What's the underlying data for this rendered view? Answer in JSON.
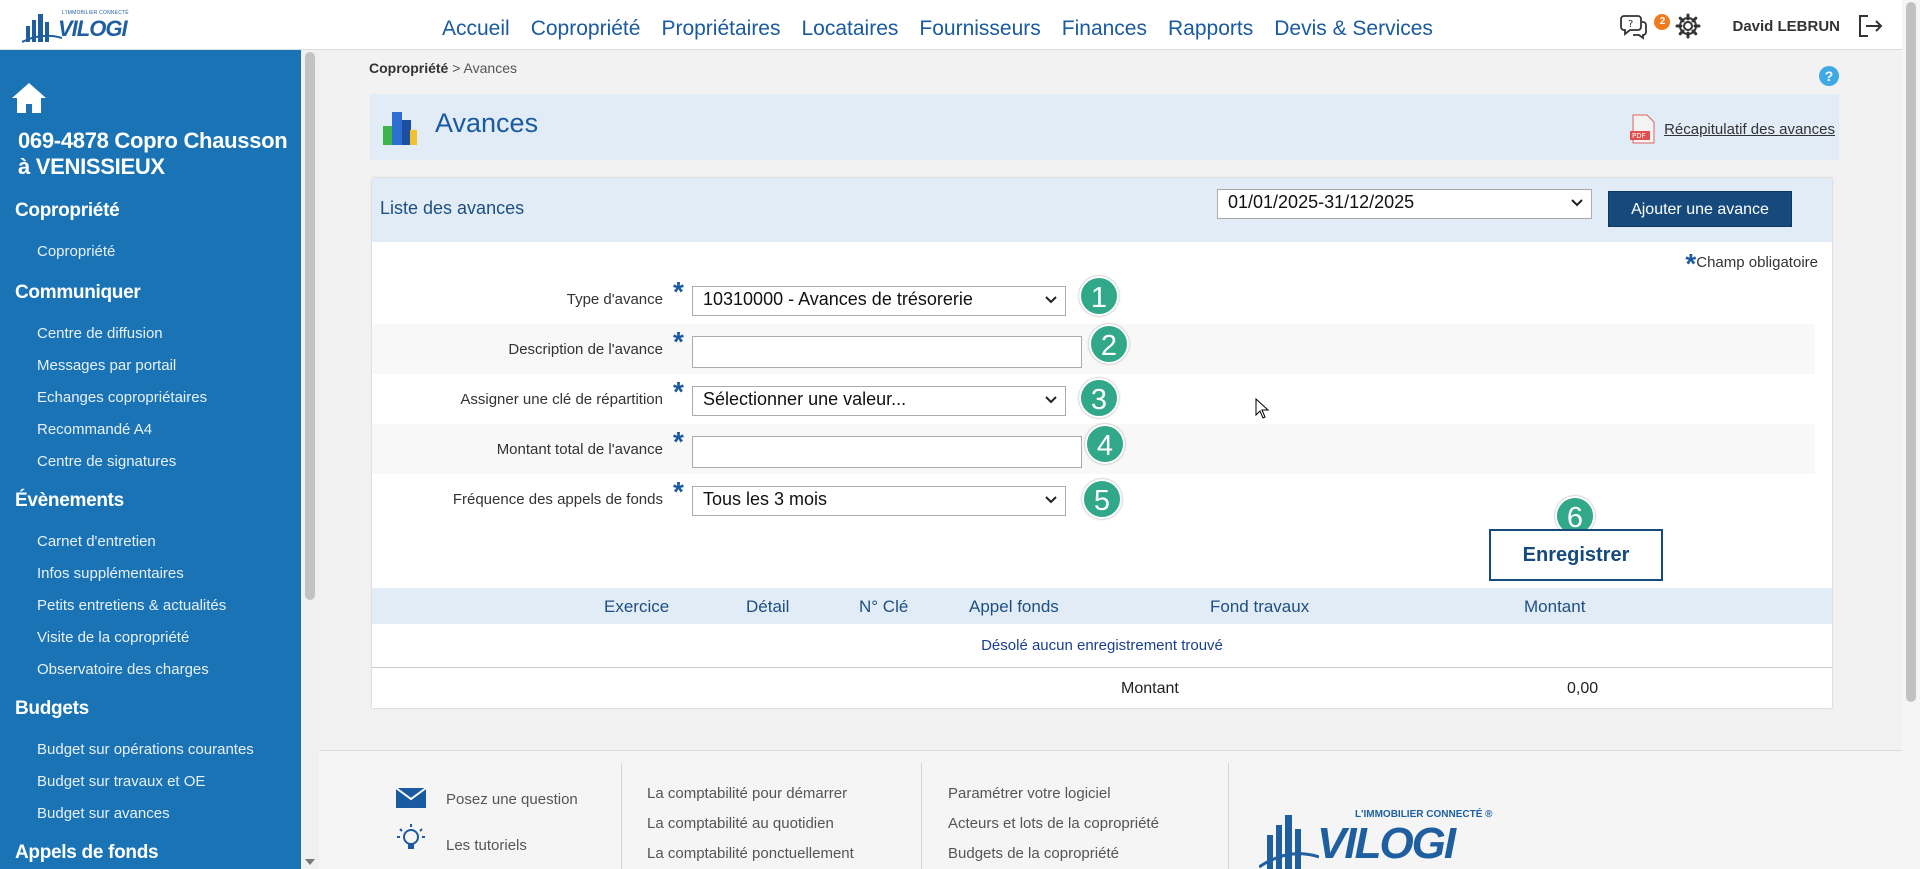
{
  "app": {
    "logo_tagline": "L'IMMOBILIER CONNECTÉ",
    "logo_word": "VILOGI"
  },
  "nav": [
    "Accueil",
    "Copropriété",
    "Propriétaires",
    "Locataires",
    "Fournisseurs",
    "Finances",
    "Rapports",
    "Devis & Services"
  ],
  "user": {
    "name": "David LEBRUN",
    "notification_count": "2"
  },
  "sidebar": {
    "copro_title": "069-4878 Copro Chausson à VENISSIEUX",
    "sections": [
      {
        "title": "Copropriété",
        "items": [
          "Copropriété"
        ]
      },
      {
        "title": "Communiquer",
        "items": [
          "Centre de diffusion",
          "Messages par portail",
          "Echanges copropriétaires",
          "Recommandé A4",
          "Centre de signatures"
        ]
      },
      {
        "title": "Évènements",
        "items": [
          "Carnet d'entretien",
          "Infos supplémentaires",
          "Petits entretiens & actualités",
          "Visite de la copropriété",
          "Observatoire des charges"
        ]
      },
      {
        "title": "Budgets",
        "items": [
          "Budget sur opérations courantes",
          "Budget sur travaux et OE",
          "Budget sur avances"
        ]
      },
      {
        "title": "Appels de fonds",
        "items": []
      }
    ]
  },
  "breadcrumb": {
    "parent": "Copropriété",
    "sep": " > ",
    "current": "Avances"
  },
  "page": {
    "title": "Avances",
    "pdf_link": "Récapitulatif des avances"
  },
  "panel": {
    "title": "Liste des avances",
    "period": "01/01/2025-31/12/2025",
    "add_button": "Ajouter une avance",
    "required_note": "Champ obligatoire",
    "required_star": "*"
  },
  "form": {
    "fields": [
      {
        "label": "Type d'avance",
        "value": "10310000 - Avances de trésorerie",
        "step": "1"
      },
      {
        "label": "Description de l'avance",
        "value": "",
        "step": "2"
      },
      {
        "label": "Assigner une clé de répartition",
        "value": "Sélectionner une valeur...",
        "step": "3"
      },
      {
        "label": "Montant total de l'avance",
        "value": "",
        "step": "4"
      },
      {
        "label": "Fréquence des appels de fonds",
        "value": "Tous les 3 mois",
        "step": "5"
      }
    ],
    "save_button": "Enregistrer",
    "save_step": "6"
  },
  "table": {
    "columns": [
      "Exercice",
      "Détail",
      "N° Clé",
      "Appel fonds",
      "Fond travaux",
      "Montant"
    ],
    "empty_message": "Désolé aucun enregistrement trouvé",
    "total_label": "Montant",
    "total_value": "0,00"
  },
  "footer": {
    "col1": [
      "Posez une question",
      "Les tutoriels"
    ],
    "col2": [
      "La comptabilité pour démarrer",
      "La comptabilité au quotidien",
      "La comptabilité ponctuellement"
    ],
    "col3": [
      "Paramétrer votre logiciel",
      "Acteurs et lots de la copropriété",
      "Budgets de la copropriété"
    ],
    "logo_tagline": "L'IMMOBILIER CONNECTÉ ®",
    "logo_word": "VILOGI"
  },
  "colors": {
    "brand_blue": "#1a73b4",
    "nav_blue": "#1a5aa0",
    "step_green": "#32a88a",
    "dark_button": "#174a7c",
    "badge_orange": "#f07b1f"
  }
}
